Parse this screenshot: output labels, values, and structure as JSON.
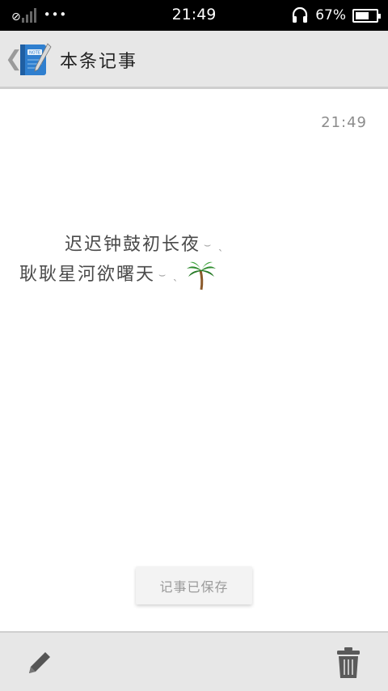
{
  "status_bar": {
    "time": "21:49",
    "battery_percent": "67%",
    "battery_level": 0.67,
    "more_indicator": "•••",
    "icons": [
      "no-sim-icon",
      "signal-icon",
      "headset-icon",
      "battery-icon"
    ]
  },
  "header": {
    "back_glyph": "❮",
    "title": "本条记事",
    "app_icon_label": "NOTE"
  },
  "note": {
    "timestamp": "21:49",
    "lines": [
      "迟迟钟鼓初长夜",
      "耿耿星河欲曙天"
    ],
    "emoji": "palm-tree"
  },
  "toast": {
    "text": "记事已保存"
  },
  "bottom_bar": {
    "icons": [
      "pencil-icon",
      "trash-icon"
    ]
  },
  "colors": {
    "bar_bg": "#e7e7e7",
    "status_bg": "#000000",
    "note_icon_blue": "#3a8fd9"
  }
}
